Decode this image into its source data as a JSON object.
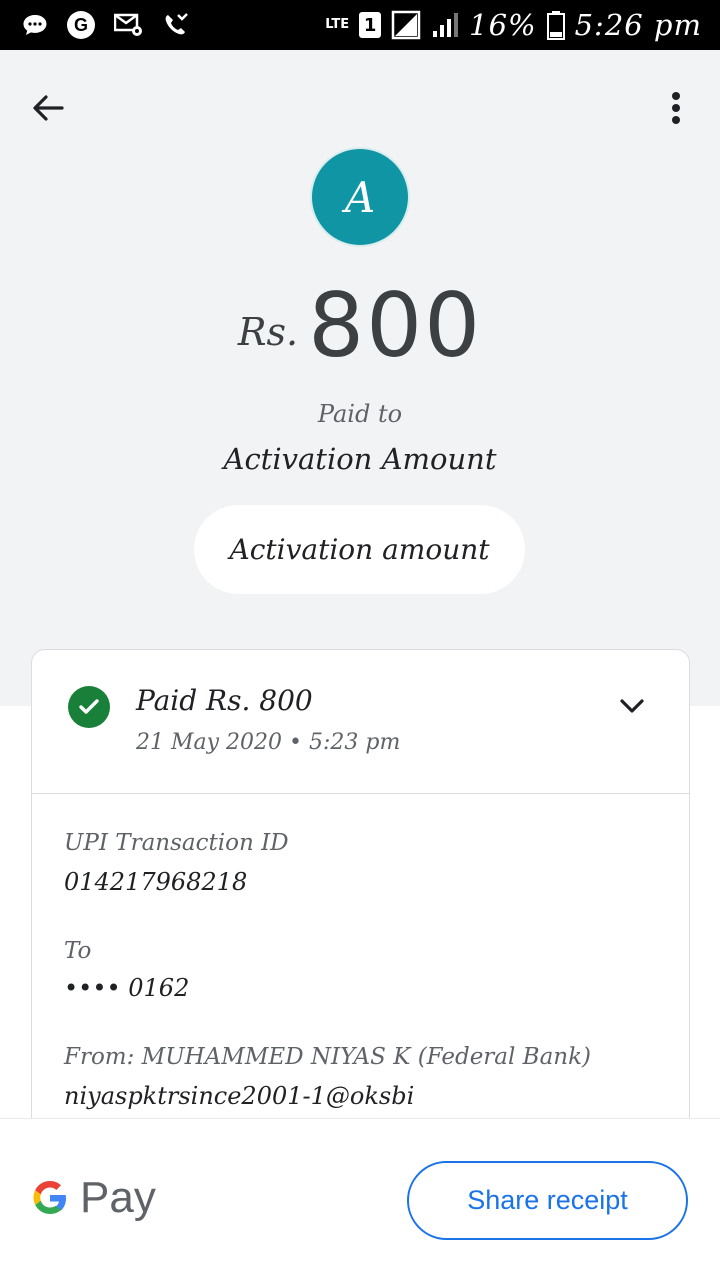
{
  "status_bar": {
    "network": "LTE",
    "sim": "1",
    "battery": "16%",
    "time": "5:26 pm"
  },
  "header": {
    "back_icon": "arrow-left-icon",
    "menu_icon": "more-vert-icon"
  },
  "payee": {
    "avatar_letter": "A",
    "avatar_color": "#0f95a3",
    "currency": "Rs.",
    "amount": "800",
    "paid_to_label": "Paid to",
    "name": "Activation Amount",
    "note": "Activation amount"
  },
  "card": {
    "status_color": "#188038",
    "summary": "Paid Rs. 800",
    "datetime": "21 May 2020 • 5:23 pm",
    "details": {
      "upi_label": "UPI Transaction ID",
      "upi_value": "014217968218",
      "to_label": "To",
      "to_value": "•••• 0162",
      "from_label": "From: MUHAMMED NIYAS K (Federal Bank)",
      "from_value": "niyaspktrsince2001-1@oksbi"
    }
  },
  "footer": {
    "brand": "Pay",
    "share_label": "Share receipt",
    "accent": "#1a73e8"
  }
}
